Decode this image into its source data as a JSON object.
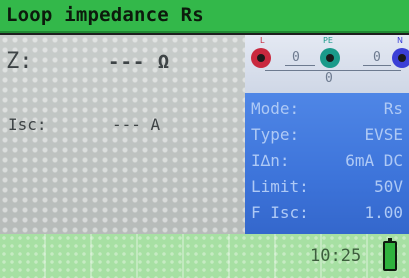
{
  "header": {
    "title": "Loop impedance Rs"
  },
  "results": {
    "z_label": "Z:",
    "z_value": "--- Ω",
    "isc_label": "Isc:",
    "isc_value": "--- A"
  },
  "terminals": [
    {
      "tag": "L",
      "reading": "0",
      "color": "#c9283e"
    },
    {
      "tag": "PE",
      "reading": "0",
      "color": "#1a9a8a"
    },
    {
      "tag": "N",
      "reading": "0",
      "color": "#3b3fd6"
    }
  ],
  "params": [
    {
      "label": "Mode:",
      "value": "Rs"
    },
    {
      "label": "Type:",
      "value": "EVSE"
    },
    {
      "label": "I∆n:",
      "value": "6mA DC"
    },
    {
      "label": "Limit:",
      "value": "50V"
    },
    {
      "label": "F Isc:",
      "value": "1.00"
    }
  ],
  "status": {
    "time": "10:25",
    "battery_icon": "battery-full-icon"
  },
  "colors": {
    "title_bar": "#33b84a",
    "param_panel": "#3d74da",
    "status_bar": "#a7e0a3"
  }
}
